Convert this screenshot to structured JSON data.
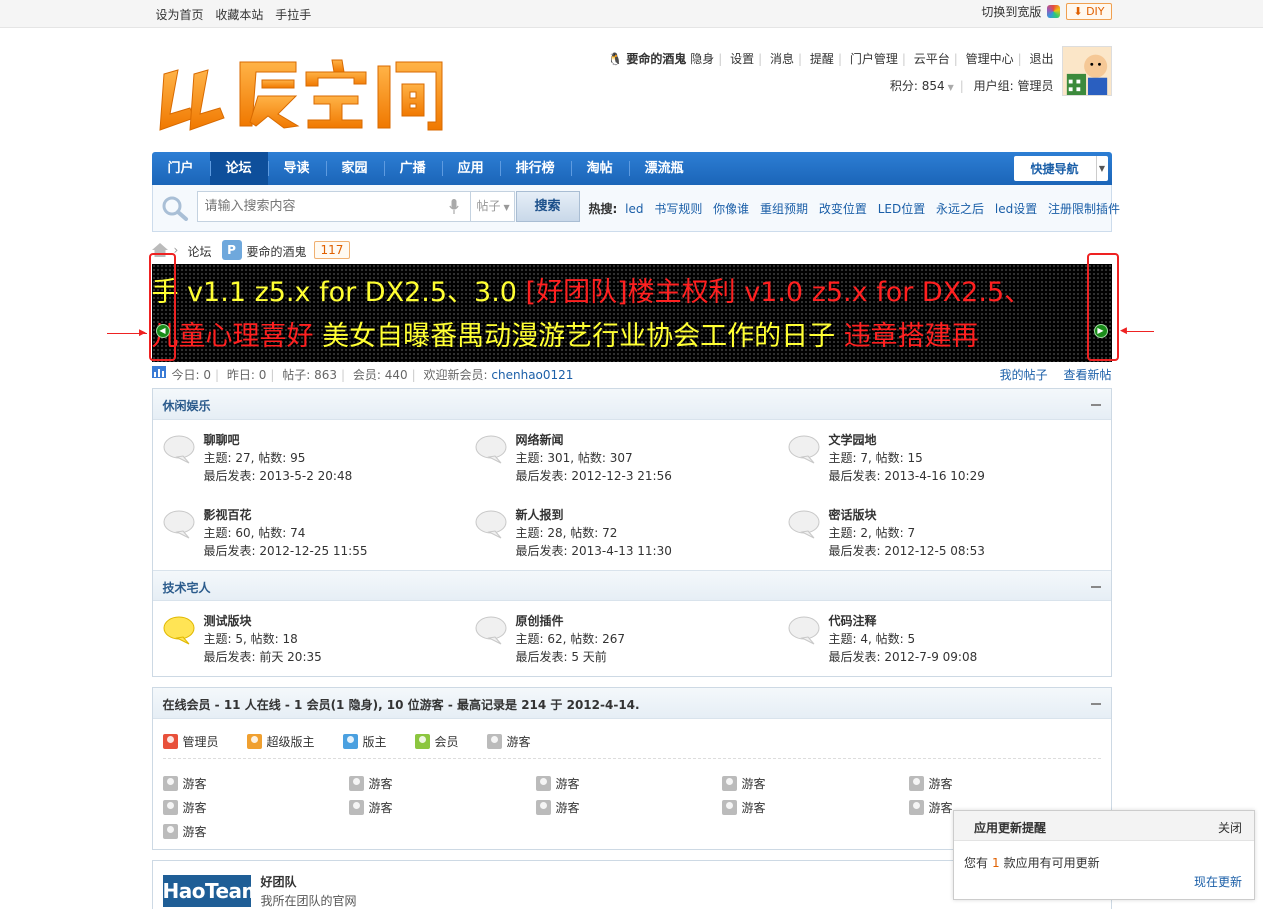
{
  "topbar": {
    "links": [
      "设为首页",
      "收藏本站",
      "手拉手"
    ],
    "wide_toggle": "切换到宽版",
    "diy": "DIY"
  },
  "header": {
    "user_name": "要命的酒鬼",
    "user_links": [
      "隐身",
      "设置",
      "消息",
      "提醒",
      "门户管理",
      "云平台",
      "管理中心",
      "退出"
    ],
    "points_label": "积分: 854",
    "group_label": "用户组: 管理员"
  },
  "nav": {
    "items": [
      "门户",
      "论坛",
      "导读",
      "家园",
      "广播",
      "应用",
      "排行榜",
      "淘帖",
      "漂流瓶"
    ],
    "active": "论坛",
    "quicknav": "快捷导航"
  },
  "search": {
    "placeholder": "请输入搜索内容",
    "scope": "帖子",
    "button": "搜索",
    "hot_label": "热搜:",
    "hot_terms": [
      "led",
      "书写规则",
      "你像谁",
      "重组预期",
      "改变位置",
      "LED位置",
      "永远之后",
      "led设置",
      "注册限制插件"
    ]
  },
  "breadcrumb": {
    "forum": "论坛",
    "user": "要命的酒鬼",
    "badge": "117"
  },
  "ticker": {
    "line1": [
      {
        "text": "手 v1.1 z5.x for DX2.5、3.0 ",
        "color": "#ffff33"
      },
      {
        "text": "[好团队]楼主权利 v1.0 z5.x for DX2.5、",
        "color": "#ff2020"
      }
    ],
    "line2": [
      {
        "text": "儿童心理喜好 ",
        "color": "#ff2020"
      },
      {
        "text": "美女自曝番禺动漫游艺行业协会工作的日子 ",
        "color": "#ffff33"
      },
      {
        "text": "违章搭建再",
        "color": "#ff2020"
      }
    ]
  },
  "stats": {
    "today": "今日: 0",
    "yesterday": "昨日: 0",
    "posts": "帖子: 863",
    "members": "会员: 440",
    "welcome": "欢迎新会员:",
    "new_member": "chenhao0121",
    "my_posts": "我的帖子",
    "new_posts": "查看新帖"
  },
  "categories": [
    {
      "title": "休闲娱乐",
      "forums": [
        {
          "name": "聊聊吧",
          "stats": "主题: 27, 帖数: 95",
          "last": "最后发表: 2013-5-2 20:48",
          "new": false
        },
        {
          "name": "网络新闻",
          "stats": "主题: 301, 帖数: 307",
          "last": "最后发表: 2012-12-3 21:56",
          "new": false
        },
        {
          "name": "文学园地",
          "stats": "主题: 7, 帖数: 15",
          "last": "最后发表: 2013-4-16 10:29",
          "new": false
        },
        {
          "name": "影视百花",
          "stats": "主题: 60, 帖数: 74",
          "last": "最后发表: 2012-12-25 11:55",
          "new": false
        },
        {
          "name": "新人报到",
          "stats": "主题: 28, 帖数: 72",
          "last": "最后发表: 2013-4-13 11:30",
          "new": false
        },
        {
          "name": "密话版块",
          "stats": "主题: 2, 帖数: 7",
          "last": "最后发表: 2012-12-5 08:53",
          "new": false
        }
      ]
    },
    {
      "title": "技术宅人",
      "forums": [
        {
          "name": "测试版块",
          "stats": "主题: 5, 帖数: 18",
          "last": "最后发表: 前天 20:35",
          "new": true
        },
        {
          "name": "原创插件",
          "stats": "主题: 62, 帖数: 267",
          "last": "最后发表: 5 天前",
          "new": false
        },
        {
          "name": "代码注释",
          "stats": "主题: 4, 帖数: 5",
          "last": "最后发表: 2012-7-9 09:08",
          "new": false
        }
      ]
    }
  ],
  "online": {
    "title": "在线会员 - 11 人在线 - 1 会员(1 隐身), 10 位游客 - 最高记录是 214 于 2012-4-14.",
    "legend": [
      {
        "label": "管理员",
        "color": "#e8503a"
      },
      {
        "label": "超级版主",
        "color": "#f0a030"
      },
      {
        "label": "版主",
        "color": "#4aa0e0"
      },
      {
        "label": "会员",
        "color": "#8cc63f"
      },
      {
        "label": "游客",
        "color": "#bbbbbb"
      }
    ],
    "guests": [
      "游客",
      "游客",
      "游客",
      "游客",
      "游客",
      "游客",
      "游客",
      "游客",
      "游客",
      "游客",
      "游客"
    ]
  },
  "team": {
    "logo_text": "HaoTeam",
    "name": "好团队",
    "desc": "我所在团队的官网"
  },
  "popup": {
    "title": "应用更新提醒",
    "close": "关闭",
    "msg_prefix": "您有",
    "count": "1",
    "msg_suffix": "款应用有可用更新",
    "action": "现在更新"
  }
}
